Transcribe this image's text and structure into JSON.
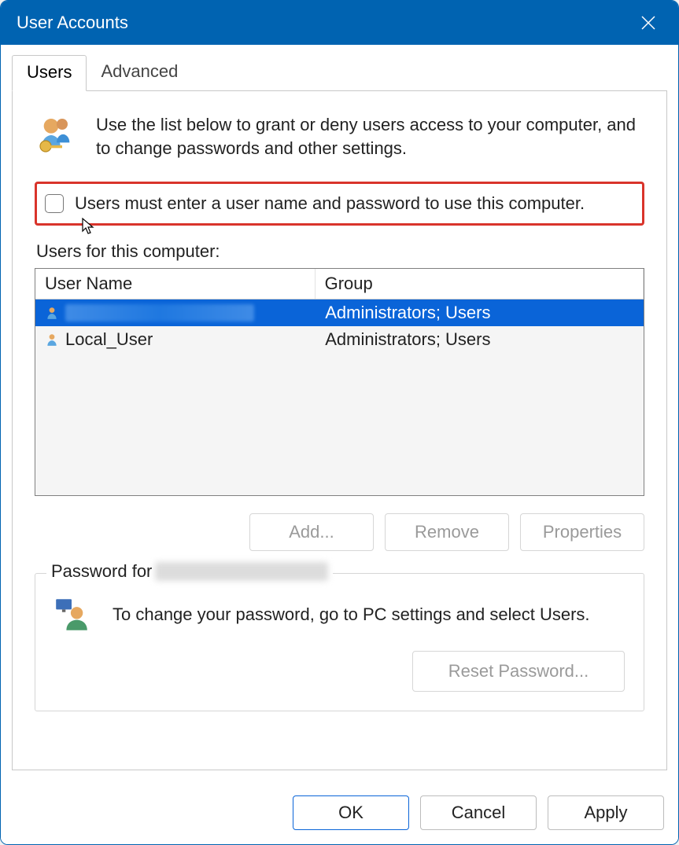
{
  "title": "User Accounts",
  "tabs": {
    "users": "Users",
    "advanced": "Advanced"
  },
  "intro_text": "Use the list below to grant or deny users access to your computer, and to change passwords and other settings.",
  "checkbox_label": "Users must enter a user name and password to use this computer.",
  "checkbox_checked": false,
  "users_heading": "Users for this computer:",
  "table": {
    "col_name": "User Name",
    "col_group": "Group",
    "rows": [
      {
        "name": "",
        "group": "Administrators; Users",
        "selected": true
      },
      {
        "name": "Local_User",
        "group": "Administrators; Users",
        "selected": false
      }
    ]
  },
  "buttons": {
    "add": "Add...",
    "remove": "Remove",
    "properties": "Properties"
  },
  "password_section": {
    "legend_prefix": "Password for",
    "text": "To change your password, go to PC settings and select Users.",
    "reset": "Reset Password..."
  },
  "footer": {
    "ok": "OK",
    "cancel": "Cancel",
    "apply": "Apply"
  }
}
